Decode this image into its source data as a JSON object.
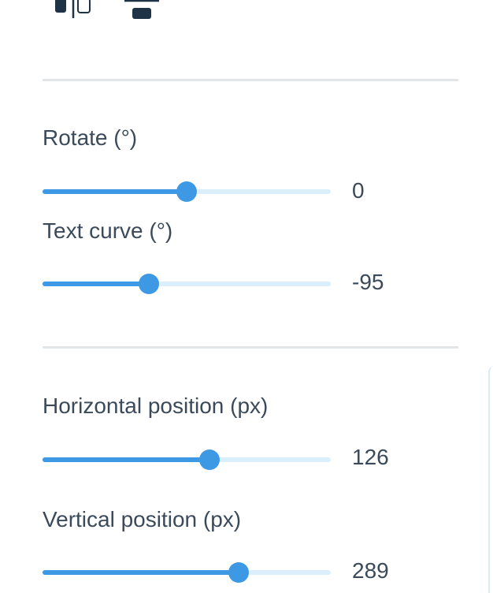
{
  "colors": {
    "accent": "#3d99e4",
    "track": "#dbeefc",
    "text": "#3b4a5a",
    "divider": "#e3e6e9",
    "icon": "#1f3347"
  },
  "top_icons": [
    {
      "icon": "align-bottom-icon"
    },
    {
      "icon": "distribute-bottom-icon"
    }
  ],
  "sliders": [
    {
      "id": "rotate",
      "label": "Rotate (°)",
      "value": "0",
      "min": -180,
      "max": 180,
      "current": 0
    },
    {
      "id": "text-curve",
      "label": "Text curve (°)",
      "value": "-95",
      "min": -360,
      "max": 360,
      "current": -95
    },
    {
      "id": "horizontal-position",
      "label": "Horizontal position (px)",
      "value": "126",
      "min": 0,
      "max": 218,
      "current": 126
    },
    {
      "id": "vertical-position",
      "label": "Vertical position (px)",
      "value": "289",
      "min": 0,
      "max": 424,
      "current": 289
    }
  ]
}
